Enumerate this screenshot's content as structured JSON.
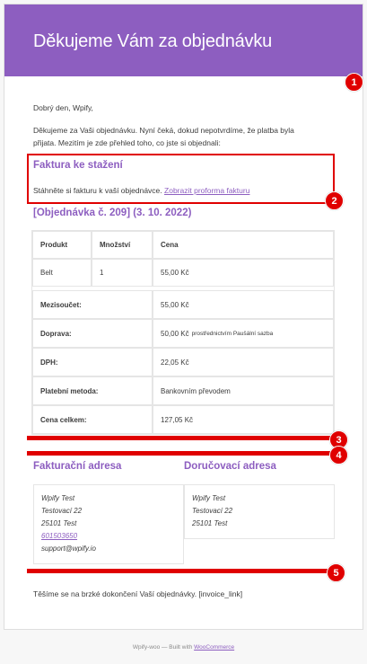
{
  "header": {
    "title": "Děkujeme Vám za objednávku"
  },
  "greeting": "Dobrý den, Wpify,",
  "intro": {
    "line1": "Děkujeme za Vaši objednávku. Nyní čeká, dokud nepotvrdíme, že platba byla",
    "line2": "přijata. Mezitím je zde přehled toho, co jste si objednali:"
  },
  "invoice_download": {
    "heading": "Faktura ke stažení",
    "text": "Stáhněte si fakturu k vaší objednávce.",
    "link": "Zobrazit proforma fakturu"
  },
  "order": {
    "heading": "[Objednávka č. 209] (3. 10. 2022)",
    "columns": [
      "Produkt",
      "Množství",
      "Cena"
    ],
    "items": [
      {
        "product": "Belt",
        "qty": "1",
        "price": "55,00 Kč"
      }
    ],
    "totals": [
      {
        "label": "Mezisoučet:",
        "value": "55,00 Kč",
        "note": ""
      },
      {
        "label": "Doprava:",
        "value": "50,00 Kč",
        "note": "prostřednictvím Paušální sazba"
      },
      {
        "label": "DPH:",
        "value": "22,05 Kč",
        "note": ""
      },
      {
        "label": "Platební metoda:",
        "value": "Bankovním převodem",
        "note": ""
      },
      {
        "label": "Cena celkem:",
        "value": "127,05 Kč",
        "note": ""
      }
    ]
  },
  "billing": {
    "heading": "Fakturační adresa",
    "name": "Wpify Test",
    "street": "Testovací 22",
    "city": "25101 Test",
    "phone": "601503650",
    "email": "support@wpify.io"
  },
  "shipping": {
    "heading": "Doručovací adresa",
    "name": "Wpify Test",
    "street": "Testovací 22",
    "city": "25101 Test"
  },
  "closing": "Těšíme se na brzké dokončení Vaší objednávky. [invoice_link]",
  "footer": {
    "prefix": "Wpify-woo — Built with",
    "link": "WooCommerce"
  },
  "annotations": {
    "m1": "1",
    "m2": "2",
    "m3": "3",
    "m4": "4",
    "m5": "5"
  },
  "colors": {
    "accent": "#8d5ec0",
    "marker": "#e00000"
  }
}
